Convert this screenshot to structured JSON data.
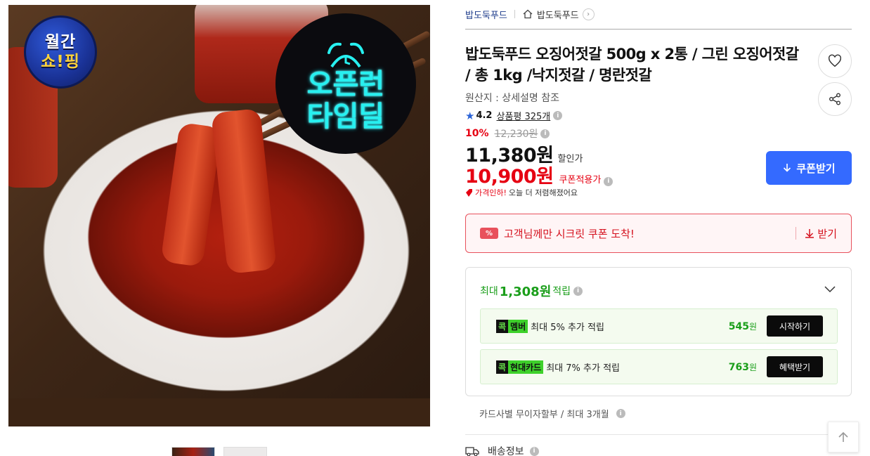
{
  "hero": {
    "badge_monthly_line1": "월간",
    "badge_monthly_line2": "쇼!핑",
    "badge_deal_line1": "오픈런",
    "badge_deal_line2": "타임딜"
  },
  "breadcrumb": {
    "brand": "밥도둑푸드",
    "store": "밥도둑푸드",
    "chevron": "›"
  },
  "product": {
    "title": "밥도둑푸드 오징어젓갈 500g x 2통 / 그린 오징어젓갈 / 총 1kg /낙지젓갈 / 명란젓갈",
    "origin": "원산지 : 상세설명 참조",
    "rating": "4.2",
    "review_link": "상품평 325개",
    "info": "i"
  },
  "price": {
    "discount_rate": "10%",
    "original_price": "12,230원",
    "sale_price": "11,380원",
    "sale_label": "할인가",
    "coupon_price": "10,900원",
    "coupon_label": "쿠폰적용가",
    "price_down_red": "가격인하!",
    "price_down_text": "오늘 더 저렴해졌어요",
    "get_coupon_button": "쿠폰받기"
  },
  "secret_coupon": {
    "icon_text": "%",
    "text": "고객님께만 시크릿 쿠폰 도착!",
    "get": "받기"
  },
  "reward": {
    "head_prefix": "최대",
    "head_amount": "1,308원",
    "head_suffix": "적립",
    "items": [
      {
        "chip_a": "콕",
        "chip_b": "멤버",
        "text": "최대 5% 추가 적립",
        "amount": "545",
        "unit": "원",
        "button": "시작하기"
      },
      {
        "chip_a": "콕",
        "chip_b": "현대카드",
        "text": "최대 7% 추가 적립",
        "amount": "763",
        "unit": "원",
        "button": "혜택받기"
      }
    ]
  },
  "installment": "카드사별 무이자할부 / 최대 3개월",
  "shipping": "배송정보",
  "colors": {
    "accent_blue": "#346aff",
    "price_red": "#e60012",
    "reward_green": "#1a9e1a"
  }
}
